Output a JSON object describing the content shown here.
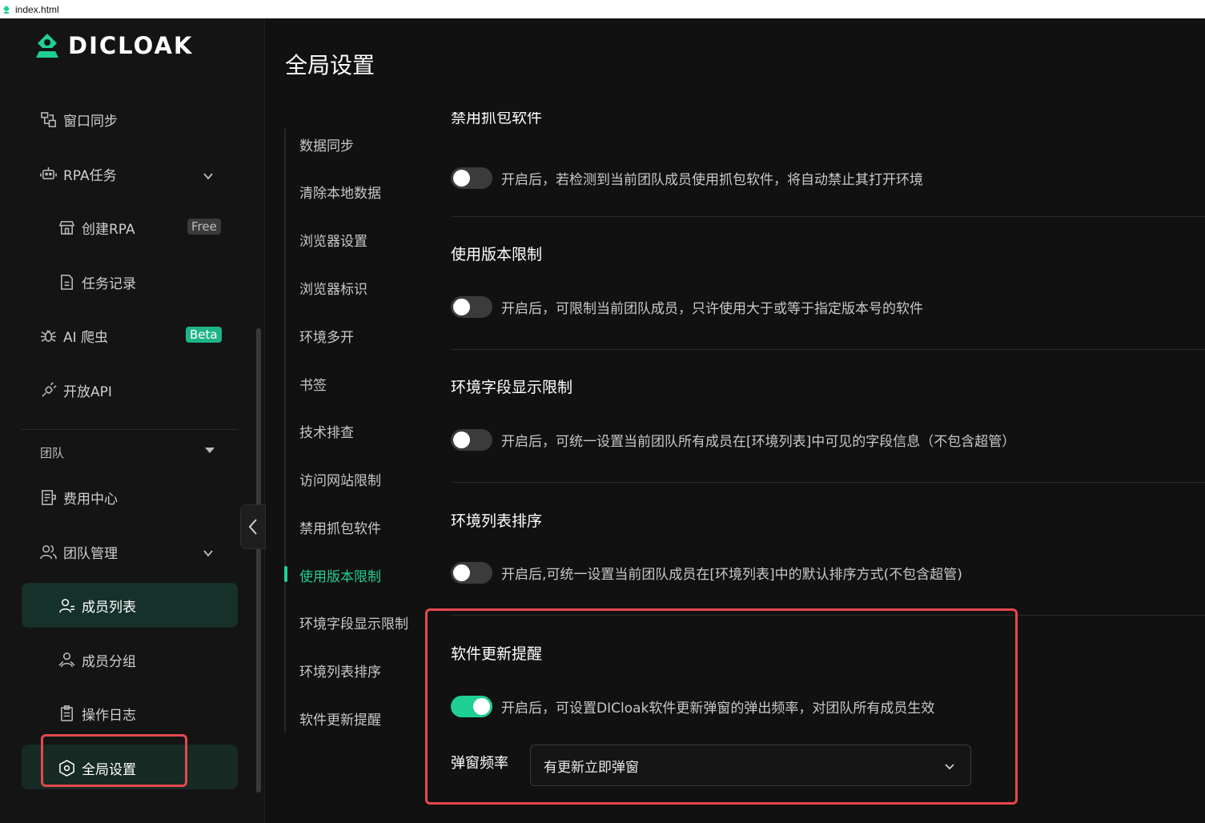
{
  "window": {
    "tab_title": "index.html"
  },
  "brand": {
    "name": "DICLOAK",
    "accent": "#1fcf95",
    "alert_box": "#e5484d"
  },
  "sidebar": {
    "window_sync": "窗口同步",
    "rpa_tasks": "RPA任务",
    "create_rpa": "创建RPA",
    "free_badge": "Free",
    "task_records": "任务记录",
    "ai_crawler": "AI 爬虫",
    "beta_badge": "Beta",
    "open_api": "开放API",
    "team_section": "团队",
    "billing_center": "费用中心",
    "team_management": "团队管理",
    "member_list": "成员列表",
    "member_groups": "成员分组",
    "operation_logs": "操作日志",
    "global_settings": "全局设置"
  },
  "page": {
    "title": "全局设置"
  },
  "subnav": {
    "items": [
      "数据同步",
      "清除本地数据",
      "浏览器设置",
      "浏览器标识",
      "环境多开",
      "书签",
      "技术排查",
      "访问网站限制",
      "禁用抓包软件",
      "使用版本限制",
      "环境字段显示限制",
      "环境列表排序",
      "软件更新提醒"
    ],
    "active": "使用版本限制"
  },
  "sections": {
    "capture": {
      "title": "禁用抓包软件",
      "desc": "开启后，若检测到当前团队成员使用抓包软件，将自动禁止其打开环境",
      "enabled": false
    },
    "version": {
      "title": "使用版本限制",
      "desc": "开启后，可限制当前团队成员，只许使用大于或等于指定版本号的软件",
      "enabled": false
    },
    "fields": {
      "title": "环境字段显示限制",
      "desc": "开启后，可统一设置当前团队所有成员在[环境列表]中可见的字段信息（不包含超管）",
      "enabled": false
    },
    "sort": {
      "title": "环境列表排序",
      "desc": "开启后,可统一设置当前团队成员在[环境列表]中的默认排序方式(不包含超管)",
      "enabled": false
    },
    "update": {
      "title": "软件更新提醒",
      "desc": "开启后，可设置DICloak软件更新弹窗的弹出频率，对团队所有成员生效",
      "enabled": true
    }
  },
  "popup_frequency": {
    "label": "弹窗频率",
    "value": "有更新立即弹窗"
  }
}
